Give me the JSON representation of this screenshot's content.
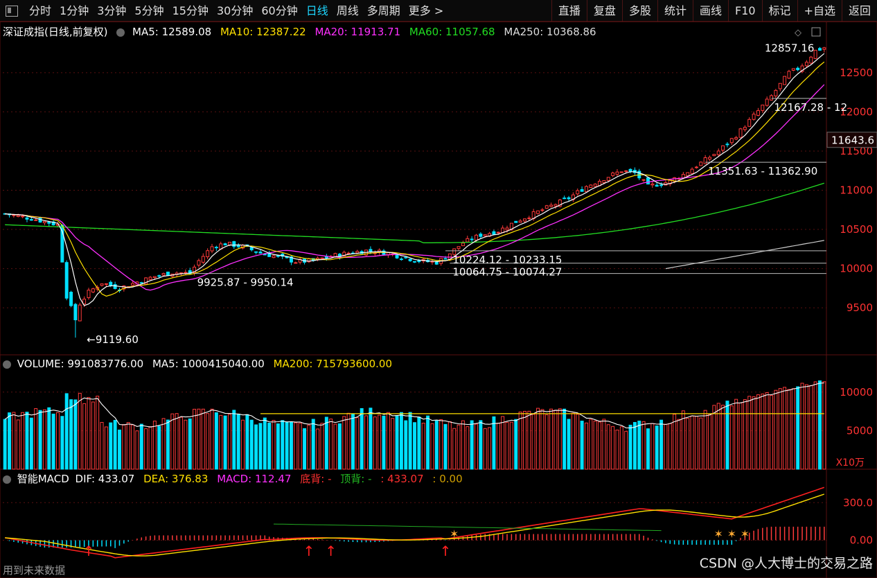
{
  "toolbar": {
    "left": [
      {
        "label": "分时",
        "name": "tab-fenshi"
      },
      {
        "label": "1分钟",
        "name": "tab-1min"
      },
      {
        "label": "3分钟",
        "name": "tab-3min"
      },
      {
        "label": "5分钟",
        "name": "tab-5min"
      },
      {
        "label": "15分钟",
        "name": "tab-15min"
      },
      {
        "label": "30分钟",
        "name": "tab-30min"
      },
      {
        "label": "60分钟",
        "name": "tab-60min"
      },
      {
        "label": "日线",
        "name": "tab-daily",
        "active": true
      },
      {
        "label": "周线",
        "name": "tab-weekly"
      },
      {
        "label": "多周期",
        "name": "tab-multi-period"
      },
      {
        "label": "更多 >",
        "name": "tab-more"
      }
    ],
    "right": [
      {
        "label": "直播",
        "name": "btn-live"
      },
      {
        "label": "复盘",
        "name": "btn-review"
      },
      {
        "label": "多股",
        "name": "btn-multi-stock"
      },
      {
        "label": "统计",
        "name": "btn-stats"
      },
      {
        "label": "画线",
        "name": "btn-draw"
      },
      {
        "label": "F10",
        "name": "btn-f10"
      },
      {
        "label": "标记",
        "name": "btn-mark"
      },
      {
        "label": "+自选",
        "name": "btn-add-watch"
      },
      {
        "label": "返回",
        "name": "btn-back"
      }
    ]
  },
  "main_legend": {
    "title": "深证成指(日线,前复权)",
    "ma5": "MA5: 12589.08",
    "ma10": "MA10: 12387.22",
    "ma20": "MA20: 11913.71",
    "ma60": "MA60: 11057.68",
    "ma250": "MA250: 10368.86"
  },
  "volume_legend": {
    "volume": "VOLUME: 991083776.00",
    "ma5": "MA5: 1000415040.00",
    "ma200": "MA200: 715793600.00"
  },
  "macd_legend": {
    "title": "智能MACD",
    "dif": "DIF: 433.07",
    "dea": "DEA: 376.83",
    "macd": "MACD: 112.47",
    "bottom_div": "底背: -",
    "top_div": "顶背: -",
    "extra1": ": 433.07",
    "extra2": ": 0.00"
  },
  "bottom_left": "用到未来数据",
  "watermark": "CSDN @人大博士的交易之路",
  "colors": {
    "up": "#ff3a3a",
    "down": "#00e0ff",
    "ma5": "#ffffff",
    "ma10": "#ffe000",
    "ma20": "#ff30ff",
    "ma60": "#22dd22",
    "ma250": "#cccccc",
    "grid": "#5a1010"
  },
  "chart_data": {
    "type": "candlestick",
    "series_name": "深证成指",
    "price_axis": {
      "ticks": [
        9500,
        10000,
        10500,
        11000,
        11500,
        12000,
        12500
      ],
      "current_price_label": "11643.6"
    },
    "volume_axis": {
      "ticks": [
        5000,
        10000
      ],
      "unit": "X10万"
    },
    "macd_axis": {
      "ticks": [
        "0.00",
        "300.0"
      ]
    },
    "annotations": [
      {
        "label": "9119.60",
        "price": 9119.6,
        "bar": 17
      },
      {
        "label": "9925.87 - 9950.14",
        "price": 9938,
        "bar": 43
      },
      {
        "label": "10224.12 - 10233.15",
        "price": 10228,
        "bar": 101
      },
      {
        "label": "10064.75 - 10074.27",
        "price": 10070,
        "bar": 101
      },
      {
        "label": "11351.63 - 11362.90",
        "price": 11357,
        "bar": 159
      },
      {
        "label": "12167.28 - 12",
        "price": 12172,
        "bar": 174
      },
      {
        "label": "12857.16",
        "price": 12857.16,
        "bar": 185
      }
    ],
    "keyframes_close": [
      [
        0,
        10700
      ],
      [
        6,
        10640
      ],
      [
        12,
        10560
      ],
      [
        14,
        9650
      ],
      [
        16,
        9350
      ],
      [
        17,
        9550
      ],
      [
        19,
        9700
      ],
      [
        22,
        9820
      ],
      [
        26,
        9750
      ],
      [
        30,
        9830
      ],
      [
        34,
        9900
      ],
      [
        38,
        9950
      ],
      [
        42,
        9940
      ],
      [
        44,
        10100
      ],
      [
        47,
        10280
      ],
      [
        50,
        10320
      ],
      [
        54,
        10280
      ],
      [
        58,
        10200
      ],
      [
        62,
        10150
      ],
      [
        66,
        10090
      ],
      [
        70,
        10100
      ],
      [
        74,
        10160
      ],
      [
        78,
        10200
      ],
      [
        82,
        10230
      ],
      [
        86,
        10210
      ],
      [
        90,
        10150
      ],
      [
        94,
        10100
      ],
      [
        98,
        10080
      ],
      [
        100,
        10150
      ],
      [
        104,
        10330
      ],
      [
        108,
        10430
      ],
      [
        112,
        10480
      ],
      [
        116,
        10600
      ],
      [
        120,
        10700
      ],
      [
        124,
        10800
      ],
      [
        128,
        10900
      ],
      [
        132,
        11050
      ],
      [
        136,
        11150
      ],
      [
        140,
        11250
      ],
      [
        143,
        11220
      ],
      [
        146,
        11050
      ],
      [
        150,
        11100
      ],
      [
        154,
        11200
      ],
      [
        158,
        11350
      ],
      [
        162,
        11500
      ],
      [
        166,
        11700
      ],
      [
        170,
        11950
      ],
      [
        174,
        12200
      ],
      [
        178,
        12500
      ],
      [
        180,
        12550
      ],
      [
        182,
        12650
      ],
      [
        184,
        12780
      ],
      [
        186,
        12820
      ]
    ],
    "macd_marks": {
      "red_arrows_at_bars": [
        69,
        74,
        100,
        19
      ],
      "gold_marks_at_bars": [
        102,
        162,
        165,
        168
      ]
    }
  }
}
